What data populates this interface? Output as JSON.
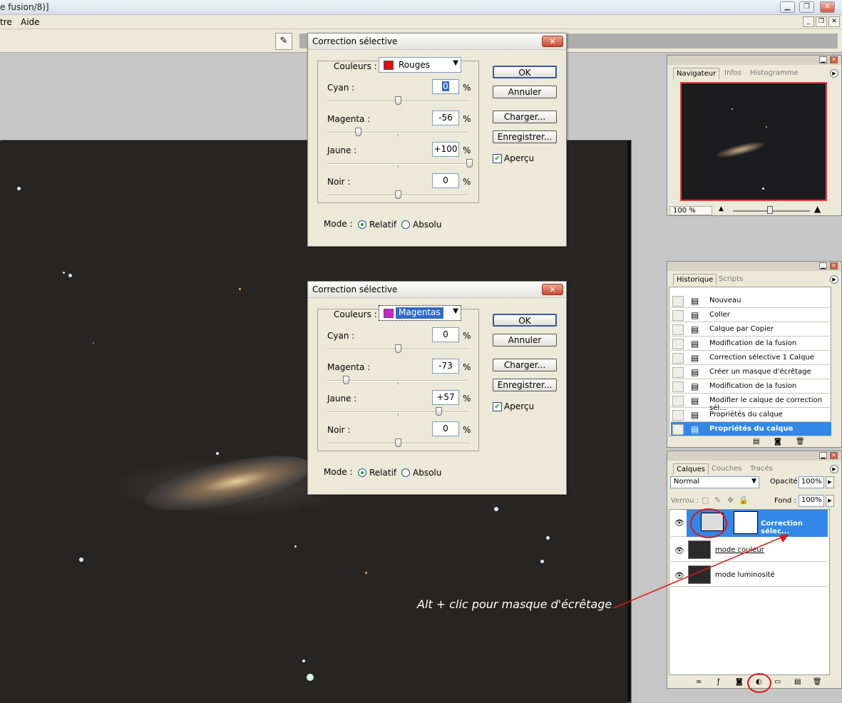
{
  "window": {
    "title": "e fusion/8)]",
    "minimize": "▁",
    "restore": "❐",
    "close": "✕"
  },
  "menu": {
    "items": [
      "tre",
      "Aide"
    ],
    "doc_min": "_",
    "doc_restore": "❐",
    "doc_close": "✕"
  },
  "dialog_red": {
    "title": "Correction sélective",
    "couleurs_label": "Couleurs :",
    "couleur_value": "Rouges",
    "couleur_swatch": "#dd1111",
    "sliders": [
      {
        "label": "Cyan :",
        "value": "0",
        "level": 0
      },
      {
        "label": "Magenta :",
        "value": "-56",
        "level": -56
      },
      {
        "label": "Jaune :",
        "value": "+100",
        "level": 100
      },
      {
        "label": "Noir :",
        "value": "0",
        "level": 0
      }
    ],
    "pct": "%",
    "ok": "OK",
    "annuler": "Annuler",
    "charger": "Charger...",
    "enregistrer": "Enregistrer...",
    "apercu": "Aperçu",
    "mode_label": "Mode :",
    "relatif": "Relatif",
    "absolu": "Absolu"
  },
  "dialog_magenta": {
    "title": "Correction sélective",
    "couleurs_label": "Couleurs :",
    "couleur_value": "Magentas",
    "couleur_swatch": "#cc22cc",
    "sliders": [
      {
        "label": "Cyan :",
        "value": "0",
        "level": 0
      },
      {
        "label": "Magenta :",
        "value": "-73",
        "level": -73
      },
      {
        "label": "Jaune :",
        "value": "+57",
        "level": 57
      },
      {
        "label": "Noir :",
        "value": "0",
        "level": 0
      }
    ],
    "pct": "%",
    "ok": "OK",
    "annuler": "Annuler",
    "charger": "Charger...",
    "enregistrer": "Enregistrer...",
    "apercu": "Aperçu",
    "mode_label": "Mode :",
    "relatif": "Relatif",
    "absolu": "Absolu"
  },
  "navigator": {
    "tabs": [
      "Navigateur",
      "Infos",
      "Histogramme"
    ],
    "zoom": "100 %"
  },
  "history": {
    "tabs": [
      "Historique",
      "Scripts"
    ],
    "items": [
      "Nouveau",
      "Coller",
      "Calque par Copier",
      "Modification de la fusion",
      "Correction sélective 1 Calque",
      "Créer un masque d'écrêtage",
      "Modification de la fusion",
      "Modifier le calque de correction sél...",
      "Propriétés du calque",
      "Propriétés du calque"
    ]
  },
  "layers": {
    "tabs": [
      "Calques",
      "Couches",
      "Tracés"
    ],
    "blend_mode": "Normal",
    "opacity_label": "Opacité:",
    "opacity": "100%",
    "lock_label": "Verrou :",
    "fill_label": "Fond :",
    "fill": "100%",
    "items": [
      {
        "name": "Correction sélec..."
      },
      {
        "name": "mode couleur"
      },
      {
        "name": "mode luminosité"
      }
    ]
  },
  "annotation": "Alt + clic pour masque d'écrêtage",
  "accent_red": "#e01515",
  "selection_blue": "#3188e8"
}
